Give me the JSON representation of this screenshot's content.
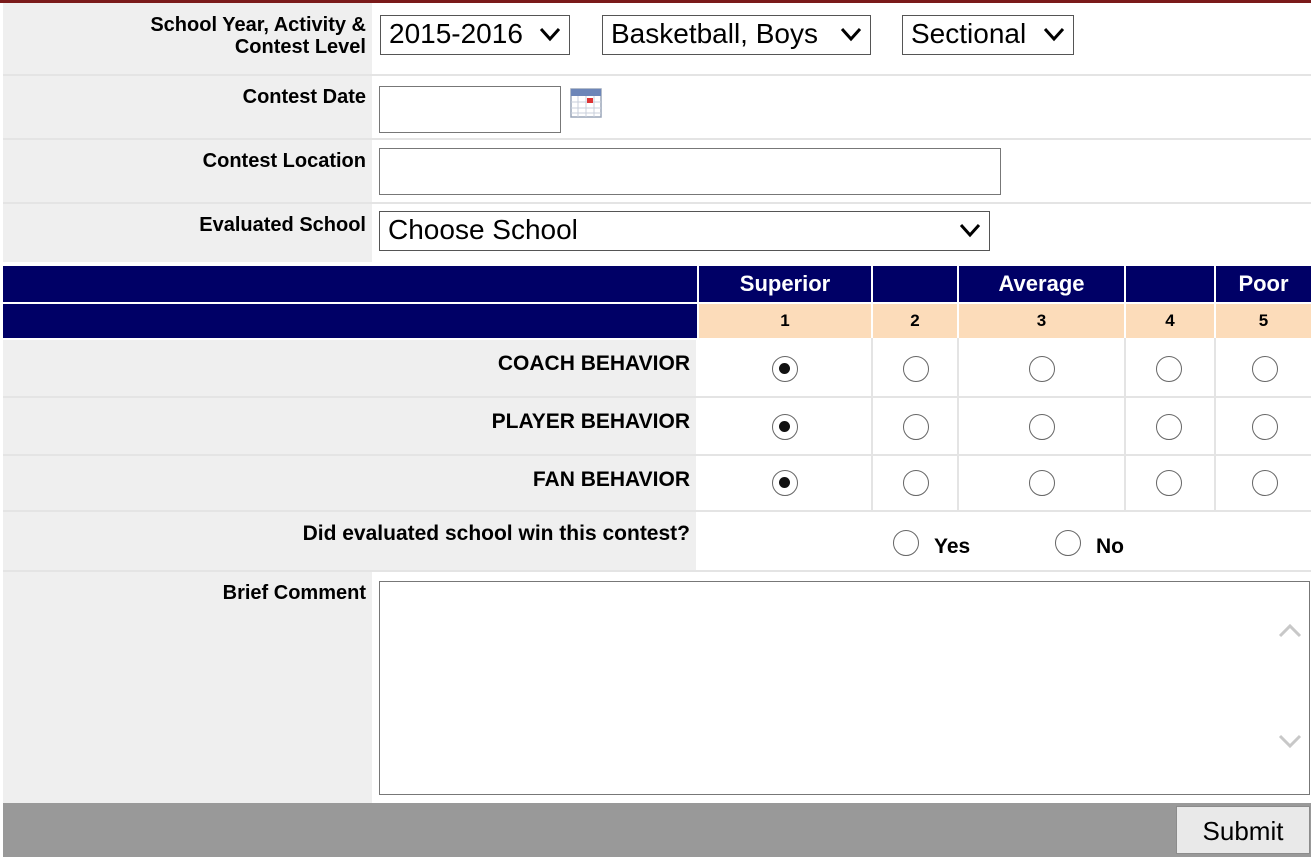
{
  "form": {
    "school_year_label_1": "School Year, Activity &",
    "school_year_label_2": "Contest Level",
    "school_year_value": "2015-2016",
    "activity_value": "Basketball, Boys",
    "level_value": "Sectional",
    "contest_date_label": "Contest Date",
    "contest_date_value": "",
    "contest_location_label": "Contest Location",
    "contest_location_value": "",
    "evaluated_school_label": "Evaluated School",
    "evaluated_school_value": "Choose School"
  },
  "rating": {
    "headers": [
      "Superior",
      "",
      "Average",
      "",
      "Poor"
    ],
    "numbers": [
      "1",
      "2",
      "3",
      "4",
      "5"
    ],
    "rows": [
      {
        "label": "COACH BEHAVIOR",
        "selected": 1
      },
      {
        "label": "PLAYER BEHAVIOR",
        "selected": 1
      },
      {
        "label": "FAN BEHAVIOR",
        "selected": 1
      }
    ],
    "win_question": "Did evaluated school win this contest?",
    "yes_label": "Yes",
    "no_label": "No",
    "win_selected": ""
  },
  "comment": {
    "label": "Brief Comment",
    "value": ""
  },
  "submit_label": "Submit",
  "colors": {
    "header_navy": "#000066",
    "number_row_peach": "#fcdcba",
    "label_bg": "#efefef",
    "footer_gray": "#999999"
  },
  "icons": {
    "calendar": "calendar-icon",
    "dropdown": "chevron-down-icon"
  }
}
